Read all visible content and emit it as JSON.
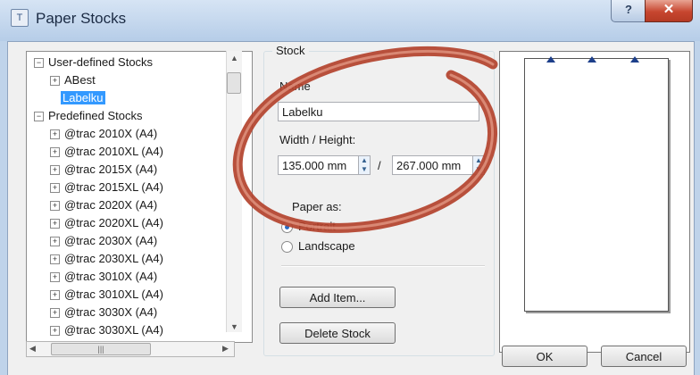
{
  "window": {
    "title": "Paper Stocks",
    "help": "?",
    "close": "✕",
    "icon": "T"
  },
  "tree": {
    "root_user": "User-defined Stocks",
    "item_abest": "ABest",
    "item_labelku": "Labelku",
    "root_predef": "Predefined Stocks",
    "predefined": [
      "@trac 2010X (A4)",
      "@trac 2010XL (A4)",
      "@trac 2015X (A4)",
      "@trac 2015XL (A4)",
      "@trac 2020X (A4)",
      "@trac 2020XL (A4)",
      "@trac 2030X (A4)",
      "@trac 2030XL (A4)",
      "@trac 3010X (A4)",
      "@trac 3010XL (A4)",
      "@trac 3030X (A4)",
      "@trac 3030XL (A4)"
    ]
  },
  "stock": {
    "group_label": "Stock",
    "name_label": "Name",
    "name_value": "Labelku",
    "size_label": "Width / Height:",
    "width_value": "135.000 mm",
    "separator": "/",
    "height_value": "267.000 mm",
    "orient_label": "Paper as:",
    "portrait_label": "Portrait",
    "landscape_label": "Landscape",
    "add_item": "Add Item...",
    "delete_stock": "Delete Stock"
  },
  "buttons": {
    "ok": "OK",
    "cancel": "Cancel"
  },
  "colors": {
    "annotation": "#b3422c",
    "selection": "#3399ff"
  }
}
